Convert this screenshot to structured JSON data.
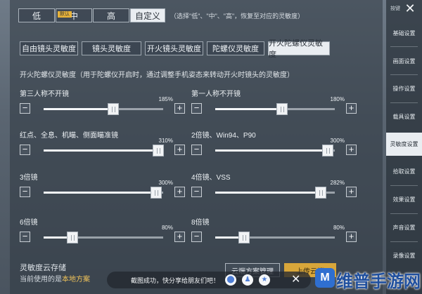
{
  "presets": {
    "items": [
      "低",
      "中",
      "高",
      "自定义"
    ],
    "active_index": 3,
    "default_tag": "默认",
    "hint": "（选择\"低\"、\"中\"、\"高\"，恢复至对应的灵敏度）"
  },
  "tabs": {
    "items": [
      "自由镜头灵敏度",
      "镜头灵敏度",
      "开火镜头灵敏度",
      "陀螺仪灵敏度",
      "开火陀螺仪灵敏度"
    ],
    "active_index": 4
  },
  "description": "开火陀螺仪灵敏度（用于陀螺仪开启时，通过调整手机姿态来转动开火时镜头的灵敏度）",
  "sliders": [
    {
      "label": "第三人称不开镜",
      "value_text": "185%",
      "level": 0.58
    },
    {
      "label": "第一人称不开镜",
      "value_text": "180%",
      "level": 0.56
    },
    {
      "label": "红点、全息、机瞄、侧面瞄准镜",
      "value_text": "310%",
      "level": 0.96
    },
    {
      "label": "2倍镜、Win94、P90",
      "value_text": "300%",
      "level": 0.94
    },
    {
      "label": "3倍镜",
      "value_text": "300%",
      "level": 0.94
    },
    {
      "label": "4倍镜、VSS",
      "value_text": "282%",
      "level": 0.88
    },
    {
      "label": "6倍镜",
      "value_text": "80%",
      "level": 0.24
    },
    {
      "label": "8倍镜",
      "value_text": "80%",
      "level": 0.24
    }
  ],
  "cloud": {
    "title": "灵敏度云存储",
    "subtitle_prefix": "当前使用的是",
    "subtitle_highlight": "本地方案",
    "manage_label": "云端方案管理",
    "upload_label": "上传云端"
  },
  "sidebar": {
    "top_tag": "按键",
    "items": [
      "基础设置",
      "画面设置",
      "操作设置",
      "载具设置",
      "灵敏度设置",
      "拾取设置",
      "效果设置",
      "声音设置",
      "录像设置"
    ],
    "active_index": 4
  },
  "toast": {
    "text": "截图成功，快分享给朋友们吧！",
    "icons": [
      "share-icon",
      "qq-icon",
      "qzone-icon"
    ]
  },
  "watermark": {
    "badge": "M",
    "text": "维普手游网"
  },
  "colors": {
    "accent": "#d8a63a",
    "active_tab_bg": "#e9edf1",
    "panel_bg": "#303842"
  }
}
